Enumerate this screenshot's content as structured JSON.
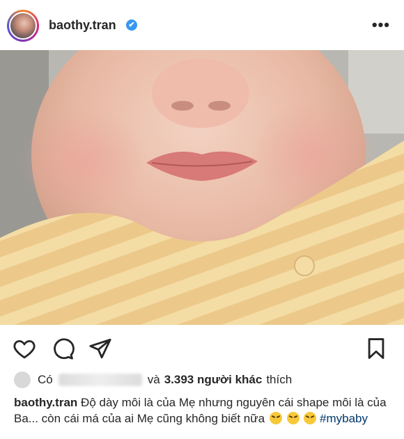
{
  "header": {
    "username": "baothy.tran",
    "verified_glyph": "✔",
    "more_glyph": "•••"
  },
  "photo": {
    "description_icon": "photo"
  },
  "actions": {
    "like_icon": "heart-icon",
    "comment_icon": "comment-icon",
    "share_icon": "send-icon",
    "save_icon": "bookmark-icon"
  },
  "likes": {
    "prefix": "Có",
    "connector": "và",
    "count_text": "3.393 người khác",
    "suffix": "thích"
  },
  "caption": {
    "username": "baothy.tran",
    "text": "Độ dày môi là của Mẹ nhưng nguyên cái shape môi là của Ba... còn cái má của ai Mẹ cũng không biết nữa",
    "hashtag": "#mybaby"
  },
  "colors": {
    "verified": "#3897f0",
    "hashtag": "#00376b",
    "text": "#262626"
  }
}
